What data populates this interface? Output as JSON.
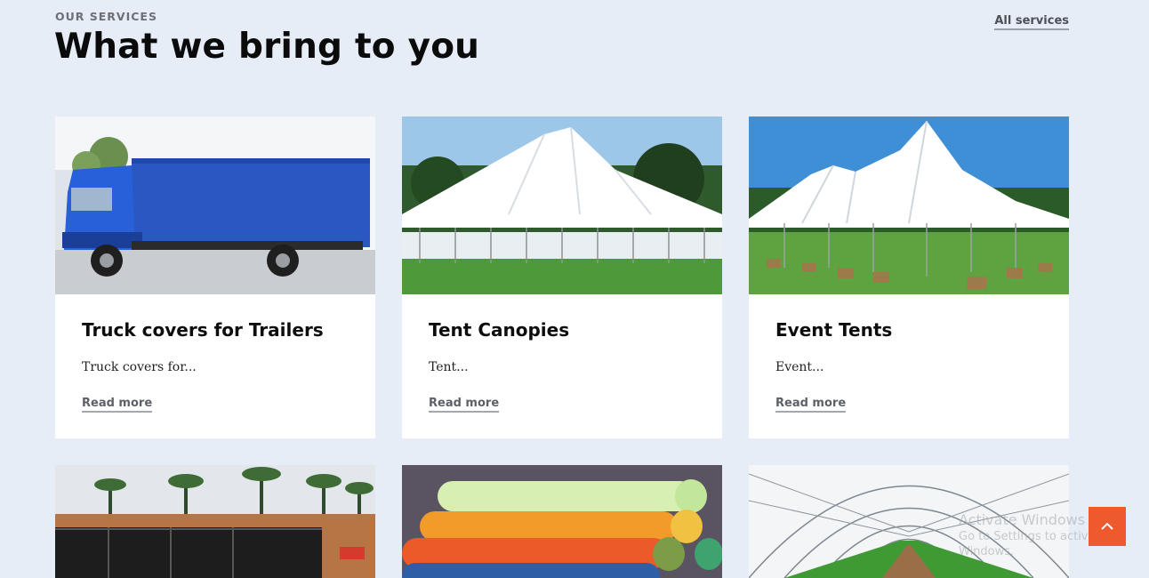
{
  "section": {
    "eyebrow": "OUR SERVICES",
    "title": "What we bring to you",
    "all_link": "All services"
  },
  "cards": [
    {
      "title": "Truck covers for Trailers",
      "excerpt": "Truck covers for...",
      "link": "Read more",
      "image": "blue-truck-photo"
    },
    {
      "title": "Tent Canopies",
      "excerpt": "Tent...",
      "link": "Read more",
      "image": "white-tent-photo"
    },
    {
      "title": "Event Tents",
      "excerpt": "Event...",
      "link": "Read more",
      "image": "event-tents-photo"
    },
    {
      "image": "fish-tank-photo"
    },
    {
      "image": "tarpaulin-rolls-photo"
    },
    {
      "image": "greenhouse-photo"
    }
  ],
  "watermark": {
    "line1": "Activate Windows",
    "line2": "Go to Settings to activate Windows."
  },
  "colors": {
    "page_bg": "#e6edf6",
    "accent": "#ee5a2e",
    "card_bg": "#ffffff"
  },
  "icons": {
    "to_top": "chevron-up-icon"
  }
}
